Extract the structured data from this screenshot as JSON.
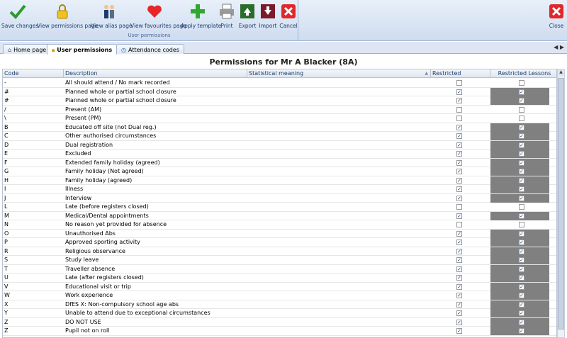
{
  "toolbar": {
    "save": "Save changes",
    "view_permissions": "View permissions page",
    "view_alias": "View alias page",
    "view_favourites": "View favourites page",
    "apply_template": "Apply template",
    "print": "Print",
    "export": "Export",
    "import": "Import",
    "cancel": "Cancel",
    "group_label": "User permissions",
    "close": "Close"
  },
  "tabs": [
    "Home page",
    "User permissions",
    "Attendance codes"
  ],
  "page_title": "Permissions for Mr A Blacker (8A)",
  "columns": [
    "Code",
    "Description",
    "Statistical meaning",
    "Restricted",
    "Restricted Lessons"
  ],
  "colors": {
    "shaded": "#808080",
    "accent": "#1e3e70"
  },
  "rows": [
    {
      "code": "-",
      "desc": "All should attend / No mark recorded",
      "restricted": false,
      "rl": false,
      "shaded": false
    },
    {
      "code": "#",
      "desc": "Planned whole or partial school closure",
      "restricted": true,
      "rl": true,
      "shaded": true
    },
    {
      "code": "#",
      "desc": "Planned whole or partial school closure",
      "restricted": true,
      "rl": true,
      "shaded": true
    },
    {
      "code": "/",
      "desc": "Present (AM)",
      "restricted": false,
      "rl": false,
      "shaded": false
    },
    {
      "code": "\\",
      "desc": "Present (PM)",
      "restricted": false,
      "rl": false,
      "shaded": false
    },
    {
      "code": "B",
      "desc": "Educated off site (not Dual reg.)",
      "restricted": true,
      "rl": true,
      "shaded": true
    },
    {
      "code": "C",
      "desc": "Other authorised circumstances",
      "restricted": true,
      "rl": true,
      "shaded": true
    },
    {
      "code": "D",
      "desc": "Dual registration",
      "restricted": true,
      "rl": true,
      "shaded": true
    },
    {
      "code": "E",
      "desc": "Excluded",
      "restricted": true,
      "rl": true,
      "shaded": true
    },
    {
      "code": "F",
      "desc": "Extended family holiday (agreed)",
      "restricted": true,
      "rl": true,
      "shaded": true
    },
    {
      "code": "G",
      "desc": "Family holiday (Not agreed)",
      "restricted": true,
      "rl": true,
      "shaded": true
    },
    {
      "code": "H",
      "desc": "Family holiday (agreed)",
      "restricted": true,
      "rl": true,
      "shaded": true
    },
    {
      "code": "I",
      "desc": "Illness",
      "restricted": true,
      "rl": true,
      "shaded": true
    },
    {
      "code": "J",
      "desc": "Interview",
      "restricted": true,
      "rl": true,
      "shaded": true
    },
    {
      "code": "L",
      "desc": "Late (before registers closed)",
      "restricted": false,
      "rl": false,
      "shaded": false
    },
    {
      "code": "M",
      "desc": "Medical/Dental appointments",
      "restricted": true,
      "rl": true,
      "shaded": true
    },
    {
      "code": "N",
      "desc": "No reason yet provided for absence",
      "restricted": false,
      "rl": false,
      "shaded": false
    },
    {
      "code": "O",
      "desc": "Unauthorised Abs",
      "restricted": true,
      "rl": true,
      "shaded": true
    },
    {
      "code": "P",
      "desc": "Approved sporting activity",
      "restricted": true,
      "rl": true,
      "shaded": true
    },
    {
      "code": "R",
      "desc": "Religious observance",
      "restricted": true,
      "rl": true,
      "shaded": true
    },
    {
      "code": "S",
      "desc": "Study leave",
      "restricted": true,
      "rl": true,
      "shaded": true
    },
    {
      "code": "T",
      "desc": "Traveller absence",
      "restricted": true,
      "rl": true,
      "shaded": true
    },
    {
      "code": "U",
      "desc": "Late (after registers closed)",
      "restricted": true,
      "rl": true,
      "shaded": true
    },
    {
      "code": "V",
      "desc": "Educational visit or trip",
      "restricted": true,
      "rl": true,
      "shaded": true
    },
    {
      "code": "W",
      "desc": "Work experience",
      "restricted": true,
      "rl": true,
      "shaded": true
    },
    {
      "code": "X",
      "desc": "DfES X: Non-compulsory school age abs",
      "restricted": true,
      "rl": true,
      "shaded": true
    },
    {
      "code": "Y",
      "desc": "Unable to attend due to exceptional circumstances",
      "restricted": true,
      "rl": true,
      "shaded": true
    },
    {
      "code": "Z",
      "desc": "DO NOT USE",
      "restricted": true,
      "rl": true,
      "shaded": true
    },
    {
      "code": "Z",
      "desc": "Pupil not on roll",
      "restricted": true,
      "rl": true,
      "shaded": true
    }
  ]
}
